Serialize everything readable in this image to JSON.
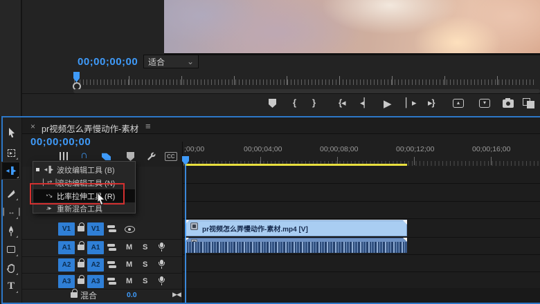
{
  "colors": {
    "accent_blue": "#3f9bfa",
    "focus_border": "#2d78c8",
    "track_button_blue": "#2f7fd6",
    "clip_video_blue": "#a9cdf2",
    "clip_audio_blue": "#2e4d7d",
    "work_bar_yellow": "#e8df3e",
    "annotation_red": "#d3302f"
  },
  "monitor": {
    "timecode": "00;00;00;00",
    "fit_select": "适合"
  },
  "icons": {
    "close": "×",
    "panel_menu": "≡",
    "chevron_down": "⌄",
    "mark_in": "{",
    "mark_out": "}",
    "go_to_in": "{◂",
    "step_back": "◂▏",
    "play": "▶",
    "step_forward": "▏▸",
    "go_to_out": "▸}",
    "lift_glyph": "▴",
    "extract_glyph": "▾",
    "magnet": "∩",
    "cc": "CC",
    "ripple_edit": "◂▐▸",
    "track_select_arrow": "▸",
    "slip": "▏↔▕",
    "type_tool": "T",
    "pan": "▶◀"
  },
  "timeline": {
    "tab_title": "pr视频怎么弄慢动作-素材",
    "timecode": "00;00;00;00",
    "ruler_labels": [
      ";00;00",
      "00;00;04;00",
      "00;00;08;00",
      "00;00;12;00",
      "00;00;16;00"
    ]
  },
  "tools_menu": {
    "items": [
      {
        "icon": "◂▐▸",
        "label": "波纹编辑工具 (B)"
      },
      {
        "icon": "▏⇄▕",
        "label": "滚动编辑工具 (N)"
      },
      {
        "icon": "◔↘",
        "label": "比率拉伸工具 (R)"
      },
      {
        "icon": "♪▸",
        "label": "重新混合工具"
      }
    ]
  },
  "tracks": {
    "v1": {
      "source": "V1",
      "target": "V1"
    },
    "a1": {
      "source": "A1",
      "target": "A1"
    },
    "a2": {
      "source": "A2",
      "target": "A2"
    },
    "a3": {
      "source": "A3",
      "target": "A3"
    },
    "mute": "M",
    "solo": "S",
    "mix_label": "混合",
    "mix_value": "0.0"
  },
  "clips": {
    "video_label": "pr视频怎么弄慢动作-素材.mp4 [V]"
  }
}
